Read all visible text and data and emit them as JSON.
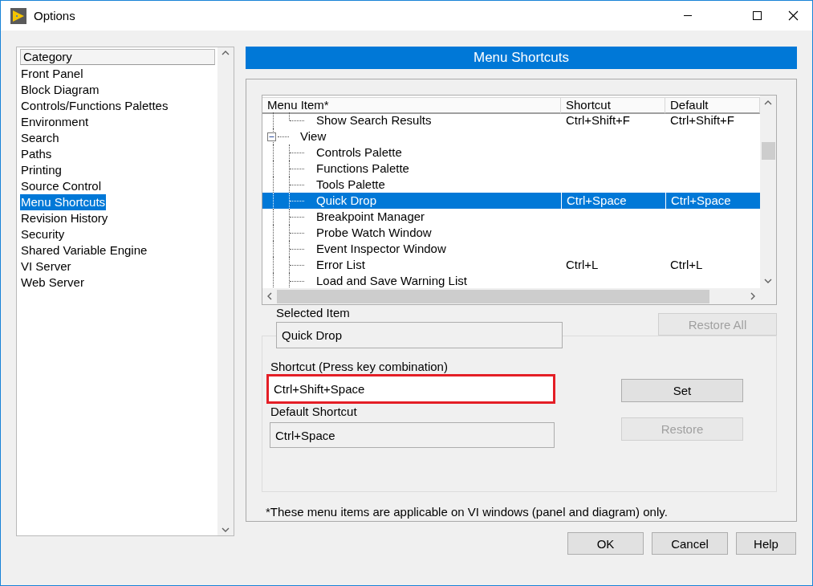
{
  "window": {
    "title": "Options"
  },
  "category_list": {
    "header": "Category",
    "items": [
      {
        "label": "Front Panel",
        "selected": false
      },
      {
        "label": "Block Diagram",
        "selected": false
      },
      {
        "label": "Controls/Functions Palettes",
        "selected": false
      },
      {
        "label": "Environment",
        "selected": false
      },
      {
        "label": "Search",
        "selected": false
      },
      {
        "label": "Paths",
        "selected": false
      },
      {
        "label": "Printing",
        "selected": false
      },
      {
        "label": "Source Control",
        "selected": false
      },
      {
        "label": "Menu Shortcuts",
        "selected": true
      },
      {
        "label": "Revision History",
        "selected": false
      },
      {
        "label": "Security",
        "selected": false
      },
      {
        "label": "Shared Variable Engine",
        "selected": false
      },
      {
        "label": "VI Server",
        "selected": false
      },
      {
        "label": "Web Server",
        "selected": false
      }
    ]
  },
  "page_header": "Menu Shortcuts",
  "table": {
    "columns": [
      "Menu Item*",
      "Shortcut",
      "Default"
    ],
    "tree": [
      {
        "children": [
          {
            "label": "Show Search Results",
            "shortcut": "Ctrl+Shift+F",
            "default": "Ctrl+Shift+F",
            "selected": false
          }
        ]
      },
      {
        "label": "View",
        "expanded": true,
        "selected": false,
        "children": [
          {
            "label": "Controls Palette",
            "selected": false
          },
          {
            "label": "Functions Palette",
            "selected": false
          },
          {
            "label": "Tools Palette",
            "selected": false
          },
          {
            "label": "Quick Drop",
            "shortcut": "Ctrl+Space",
            "default": "Ctrl+Space",
            "selected": true
          },
          {
            "label": "Breakpoint Manager",
            "selected": false
          },
          {
            "label": "Probe Watch Window",
            "selected": false
          },
          {
            "label": "Event Inspector Window",
            "selected": false
          },
          {
            "label": "Error List",
            "shortcut": "Ctrl+L",
            "default": "Ctrl+L",
            "selected": false
          },
          {
            "label": "Load and Save Warning List",
            "selected": false
          }
        ]
      }
    ]
  },
  "restore_all_button": {
    "label": "Restore All",
    "disabled": true
  },
  "selected_item": {
    "label": "Selected Item",
    "value": "Quick Drop"
  },
  "shortcut": {
    "label": "Shortcut (Press key combination)",
    "value": "Ctrl+Shift+Space",
    "highlighted": true
  },
  "set_button": {
    "label": "Set",
    "disabled": false
  },
  "default_shortcut": {
    "label": "Default Shortcut",
    "value": "Ctrl+Space"
  },
  "restore_button": {
    "label": "Restore",
    "disabled": true
  },
  "footnote": "*These menu items are applicable on VI windows (panel and diagram) only.",
  "buttons": [
    {
      "label": "OK"
    },
    {
      "label": "Cancel"
    },
    {
      "label": "Help"
    }
  ]
}
